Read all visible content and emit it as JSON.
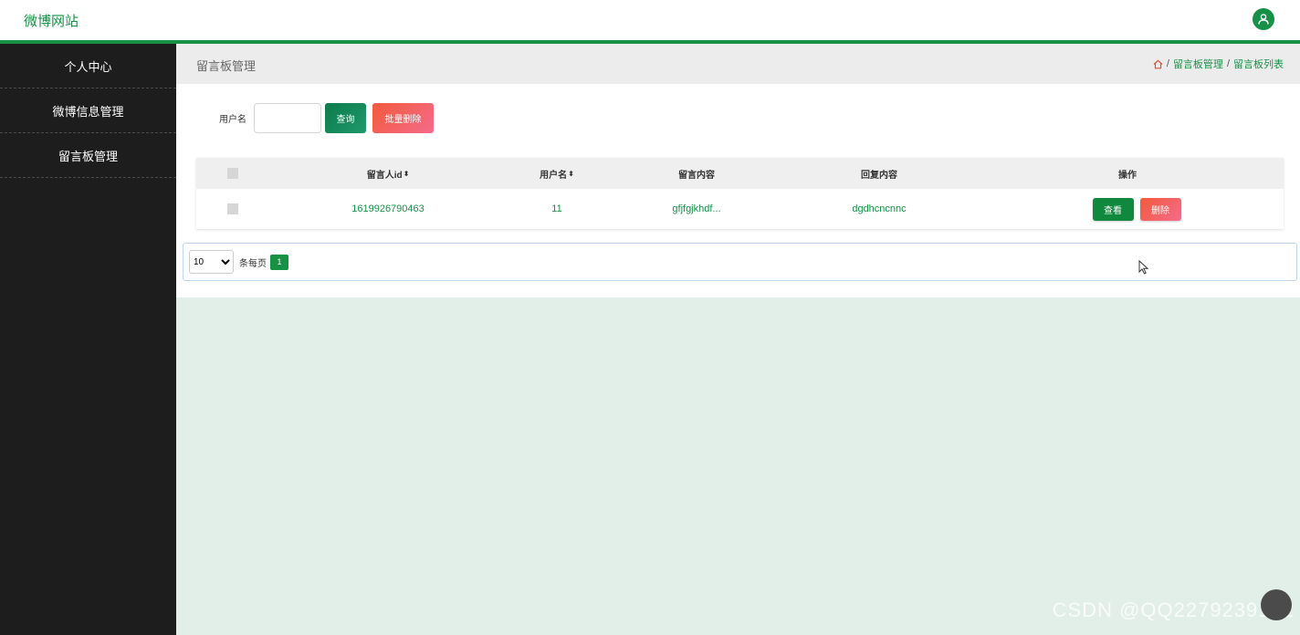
{
  "header": {
    "brand": "微博网站",
    "user_icon": "user-icon",
    "accent": "#169146"
  },
  "sidebar": {
    "items": [
      {
        "label": "个人中心"
      },
      {
        "label": "微博信息管理"
      },
      {
        "label": "留言板管理"
      }
    ]
  },
  "page": {
    "title": "留言板管理",
    "breadcrumb": {
      "home_icon": "home-icon",
      "sep": "/",
      "level1": "留言板管理",
      "level2": "留言板列表"
    }
  },
  "search": {
    "label": "用户名",
    "value": "",
    "query_button": "查询",
    "batch_delete_button": "批量删除"
  },
  "table": {
    "headers": {
      "sender_id": "留言人id",
      "username": "用户名",
      "content": "留言内容",
      "reply": "回复内容",
      "actions": "操作"
    },
    "sort_icon": "sort-icon",
    "rows": [
      {
        "sender_id": "1619926790463",
        "username": "11",
        "content": "gfjfgjkhdf...",
        "reply": "dgdhcncnnc",
        "view_button": "查看",
        "delete_button": "删除"
      }
    ]
  },
  "pagination": {
    "page_size": "10",
    "per_page_label": "条每页",
    "current_page": "1"
  },
  "watermark": "CSDN @QQ2279239102"
}
